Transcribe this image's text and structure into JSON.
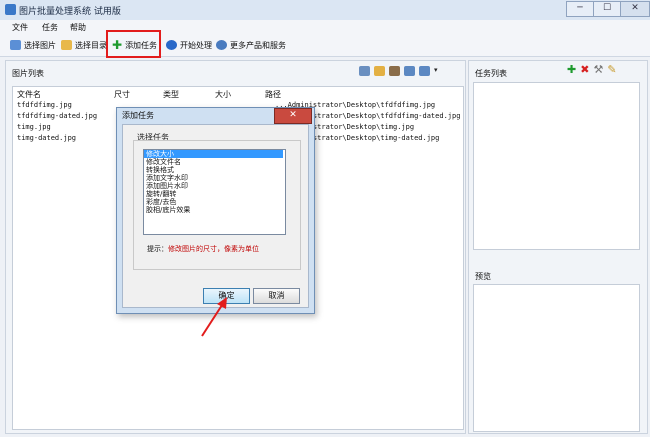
{
  "window": {
    "title": "图片批量处理系统 试用版",
    "min": "─",
    "max": "☐",
    "close": "✕"
  },
  "menu": [
    "文件",
    "任务",
    "帮助"
  ],
  "toolbar": {
    "select_image": "选择图片",
    "select_folder": "选择目录",
    "add_task": "添加任务",
    "start": "开始处理",
    "more": "更多产品和服务"
  },
  "left_pane": {
    "title": "图片列表",
    "columns": [
      "文件名",
      "尺寸",
      "类型",
      "大小",
      "路径"
    ],
    "rows": [
      {
        "name": "tfdfdfimg.jpg",
        "path": "...Administrator\\Desktop\\tfdfdfimg.jpg"
      },
      {
        "name": "tfdfdfimg-dated.jpg",
        "path": "...Administrator\\Desktop\\tfdfdfimg-dated.jpg"
      },
      {
        "name": "timg.jpg",
        "path": "...Administrator\\Desktop\\timg.jpg"
      },
      {
        "name": "timg-dated.jpg",
        "path": "...Administrator\\Desktop\\timg-dated.jpg"
      }
    ]
  },
  "right_pane": {
    "task_title": "任务列表",
    "preview_title": "预览"
  },
  "dialog": {
    "title": "添加任务",
    "close": "✕",
    "label": "选择任务",
    "options": [
      "修改大小",
      "修改文件名",
      "转换格式",
      "添加文字水印",
      "添加图片水印",
      "旋转/翻转",
      "彩度/去色",
      "胶相/底片效果"
    ],
    "hint_prefix": "提示：",
    "hint_text": "修改图片的尺寸，像素为单位",
    "ok": "确定",
    "cancel": "取消"
  },
  "colors": {
    "highlight": "#e21c1c",
    "selection": "#3399ff",
    "hint": "#c00000"
  }
}
